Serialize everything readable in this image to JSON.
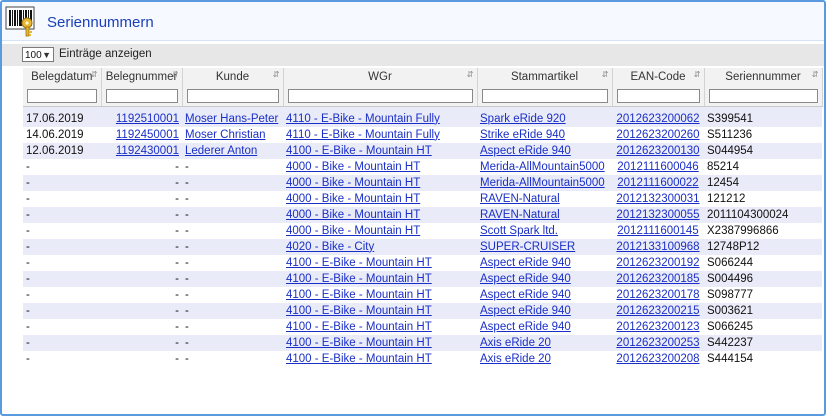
{
  "window": {
    "title": "Seriennummern"
  },
  "toolbar": {
    "page_length": "100",
    "page_length_label": "Einträge anzeigen"
  },
  "table": {
    "columns": [
      "Belegdatum",
      "Belegnummer",
      "Kunde",
      "WGr",
      "Stammartikel",
      "EAN-Code",
      "Seriennummer"
    ],
    "rows": [
      [
        "17.06.2019",
        "1192510001",
        "Moser Hans-Peter",
        "4110 - E-Bike - Mountain Fully",
        "Spark eRide 920",
        "2012623200062",
        "S399541"
      ],
      [
        "14.06.2019",
        "1192450001",
        "Moser Christian",
        "4110 - E-Bike - Mountain Fully",
        "Strike eRide 940",
        "2012623200260",
        "S511236"
      ],
      [
        "12.06.2019",
        "1192430001",
        "Lederer Anton",
        "4100 - E-Bike - Mountain HT",
        "Aspect eRide 940",
        "2012623200130",
        "S044954"
      ],
      [
        "-",
        "-",
        "-",
        "4000 - Bike - Mountain HT",
        "Merida-AllMountain5000",
        "2012111600046",
        "85214"
      ],
      [
        "-",
        "-",
        "-",
        "4000 - Bike - Mountain HT",
        "Merida-AllMountain5000",
        "2012111600022",
        "12454"
      ],
      [
        "-",
        "-",
        "-",
        "4000 - Bike - Mountain HT",
        "RAVEN-Natural",
        "2012132300031",
        "121212"
      ],
      [
        "-",
        "-",
        "-",
        "4000 - Bike - Mountain HT",
        "RAVEN-Natural",
        "2012132300055",
        "2011104300024"
      ],
      [
        "-",
        "-",
        "-",
        "4000 - Bike - Mountain HT",
        "Scott Spark ltd.",
        "2012111600145",
        "X2387996866"
      ],
      [
        "-",
        "-",
        "-",
        "4020 - Bike - City",
        "SUPER-CRUISER",
        "2012133100968",
        "12748P12"
      ],
      [
        "-",
        "-",
        "-",
        "4100 - E-Bike - Mountain HT",
        "Aspect eRide 940",
        "2012623200192",
        "S066244"
      ],
      [
        "-",
        "-",
        "-",
        "4100 - E-Bike - Mountain HT",
        "Aspect eRide 940",
        "2012623200185",
        "S004496"
      ],
      [
        "-",
        "-",
        "-",
        "4100 - E-Bike - Mountain HT",
        "Aspect eRide 940",
        "2012623200178",
        "S098777"
      ],
      [
        "-",
        "-",
        "-",
        "4100 - E-Bike - Mountain HT",
        "Aspect eRide 940",
        "2012623200215",
        "S003621"
      ],
      [
        "-",
        "-",
        "-",
        "4100 - E-Bike - Mountain HT",
        "Aspect eRide 940",
        "2012623200123",
        "S066245"
      ],
      [
        "-",
        "-",
        "-",
        "4100 - E-Bike - Mountain HT",
        "Axis eRide 20",
        "2012623200253",
        "S442237"
      ],
      [
        "-",
        "-",
        "-",
        "4100 - E-Bike - Mountain HT",
        "Axis eRide 20",
        "2012623200208",
        "S444154"
      ]
    ]
  }
}
